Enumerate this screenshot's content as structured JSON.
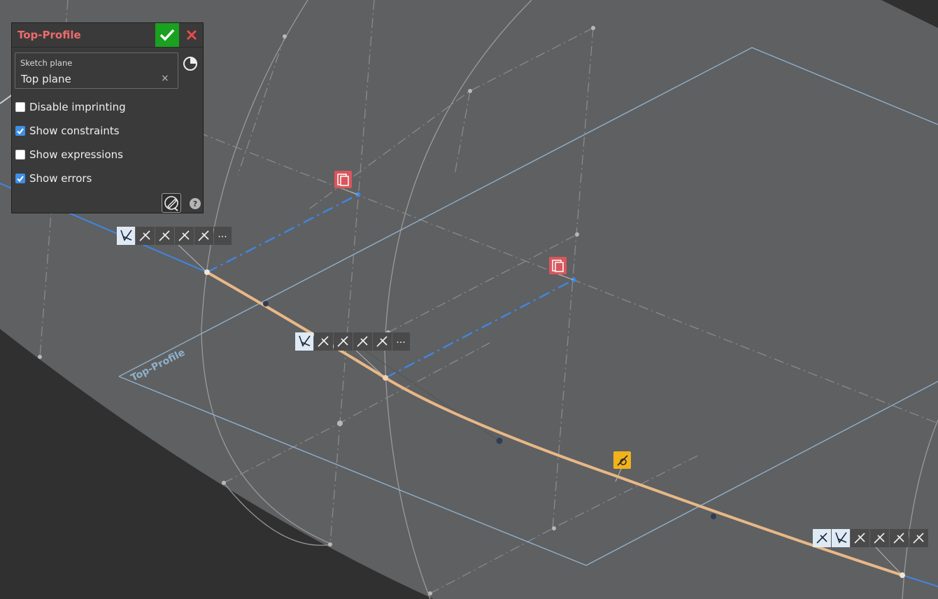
{
  "panel": {
    "title": "Top-Profile",
    "sketch_plane_label": "Sketch plane",
    "sketch_plane_value": "Top plane",
    "clear_symbol": "×",
    "help_symbol": "?",
    "options": [
      {
        "label": "Disable imprinting",
        "checked": false
      },
      {
        "label": "Show constraints",
        "checked": true
      },
      {
        "label": "Show expressions",
        "checked": false
      },
      {
        "label": "Show errors",
        "checked": true
      }
    ]
  },
  "viewport": {
    "plane_label": "Top-Profile",
    "overflow_symbol": "···",
    "colors": {
      "background": "#303030",
      "surface": "#5f6062",
      "plane_outline": "#8fb0ca",
      "sketch_blue": "#3f86e0",
      "profile_curve": "#e8b887",
      "error_badge": "#d9565c",
      "warning_badge": "#f2b21b",
      "accept": "#19a11f",
      "cancel": "#e84c4c"
    }
  }
}
